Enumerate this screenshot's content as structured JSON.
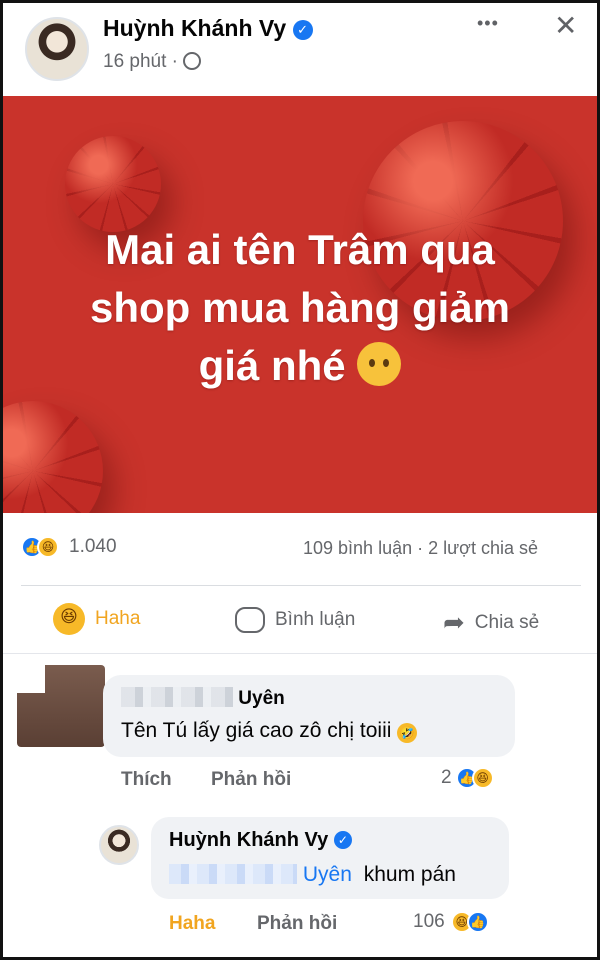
{
  "post": {
    "author": "Huỳnh Khánh Vy",
    "time": "16 phút ·",
    "privacy_icon": "globe-icon",
    "close_glyph": "✕",
    "more_glyph": "•••",
    "banner_lines": [
      "Mai ai tên Trâm qua",
      "shop mua hàng giảm",
      "giá nhé"
    ],
    "banner_color": "#c9332b"
  },
  "stats": {
    "reactions_count": "1.040",
    "comments_shares": "109 bình luận · 2 lượt chia sẻ"
  },
  "actions": {
    "haha": "Haha",
    "comment": "Bình luận",
    "share": "Chia sẻ"
  },
  "comment1": {
    "name": "Uyên",
    "text": "Tên Tú lấy giá cao zô chị toiii",
    "like": "Thích",
    "reply": "Phản hồi",
    "reaction_count": "2"
  },
  "reply1": {
    "name": "Huỳnh Khánh Vy",
    "mention": "Uyên",
    "text": "khum pán",
    "haha": "Haha",
    "reply": "Phản hồi",
    "reaction_count": "106"
  },
  "colors": {
    "accent": "#1877f2",
    "haha": "#f7b928"
  }
}
